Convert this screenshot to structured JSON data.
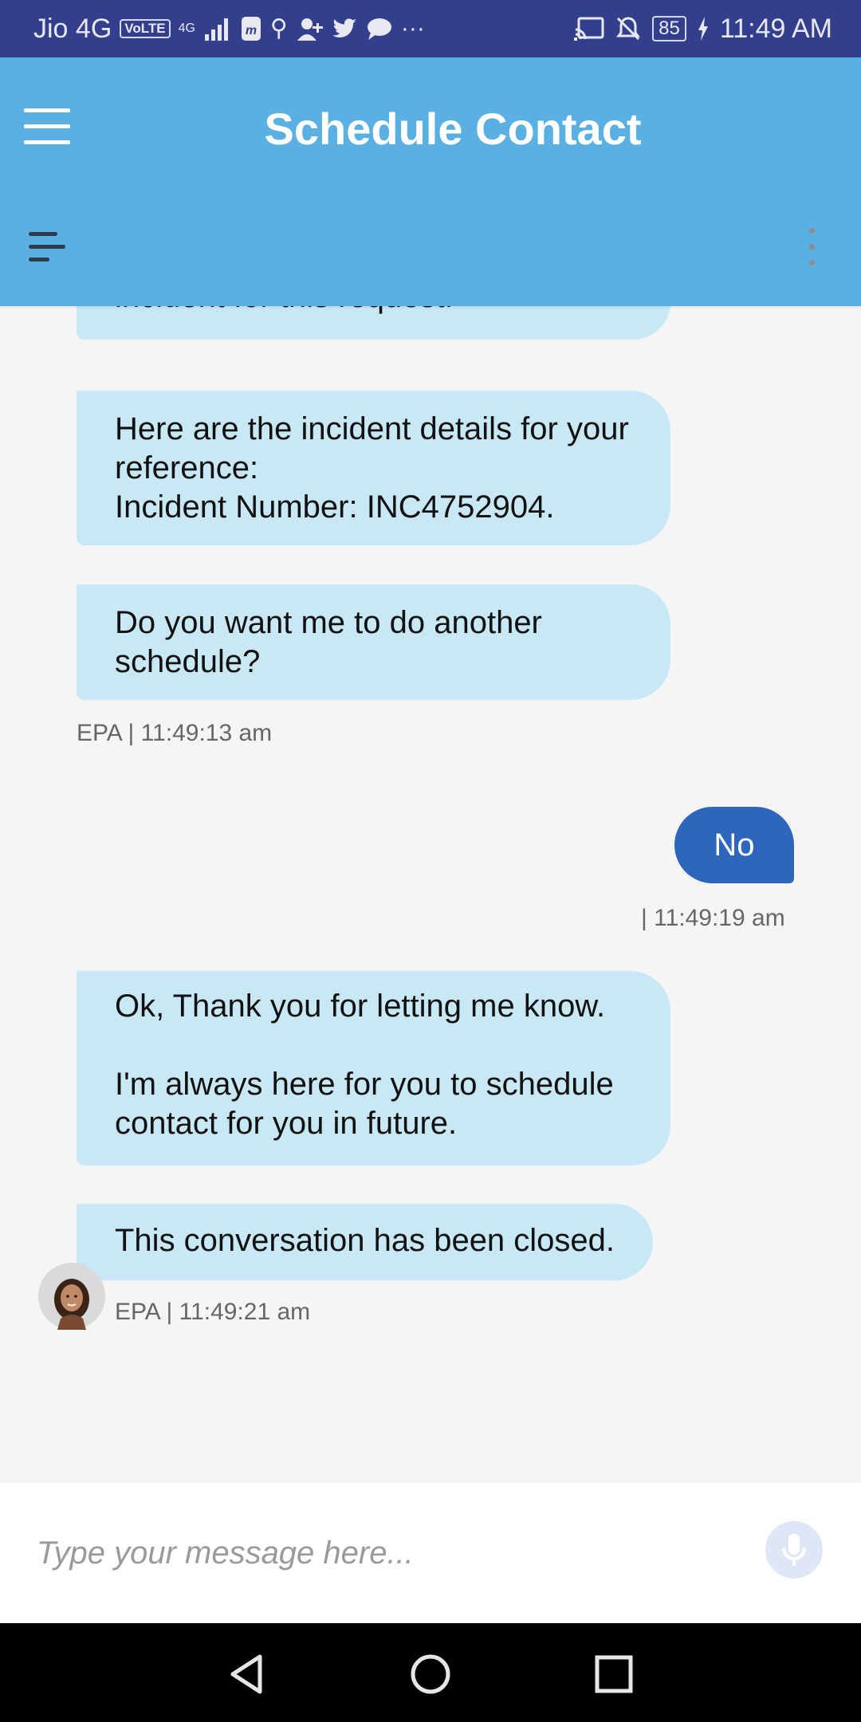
{
  "status_bar": {
    "carrier": "Jio 4G",
    "volte": "VoLTE",
    "network": "4G",
    "battery": "85",
    "time": "11:49 AM"
  },
  "header": {
    "title": "Schedule Contact"
  },
  "messages": {
    "partial": "incident for this request.",
    "incident": "Here are the incident details for your reference:\nIncident Number: INC4752904.",
    "another": "Do you want me to do another schedule?",
    "meta1": "EPA | 11:49:13 am",
    "user_reply": "No",
    "user_meta": "| 11:49:19 am",
    "thanks": "Ok, Thank you for letting me know.\n\nI'm always here for you to schedule contact for you in future.",
    "closed": "This conversation has been closed.",
    "meta2": "EPA | 11:49:21 am"
  },
  "input": {
    "placeholder": "Type your message here..."
  },
  "colors": {
    "status_bar": "#333f8c",
    "header": "#5ab0e2",
    "bot_bubble": "#c9e8f6",
    "user_bubble": "#2f66bd",
    "background": "#f5f5f5"
  }
}
